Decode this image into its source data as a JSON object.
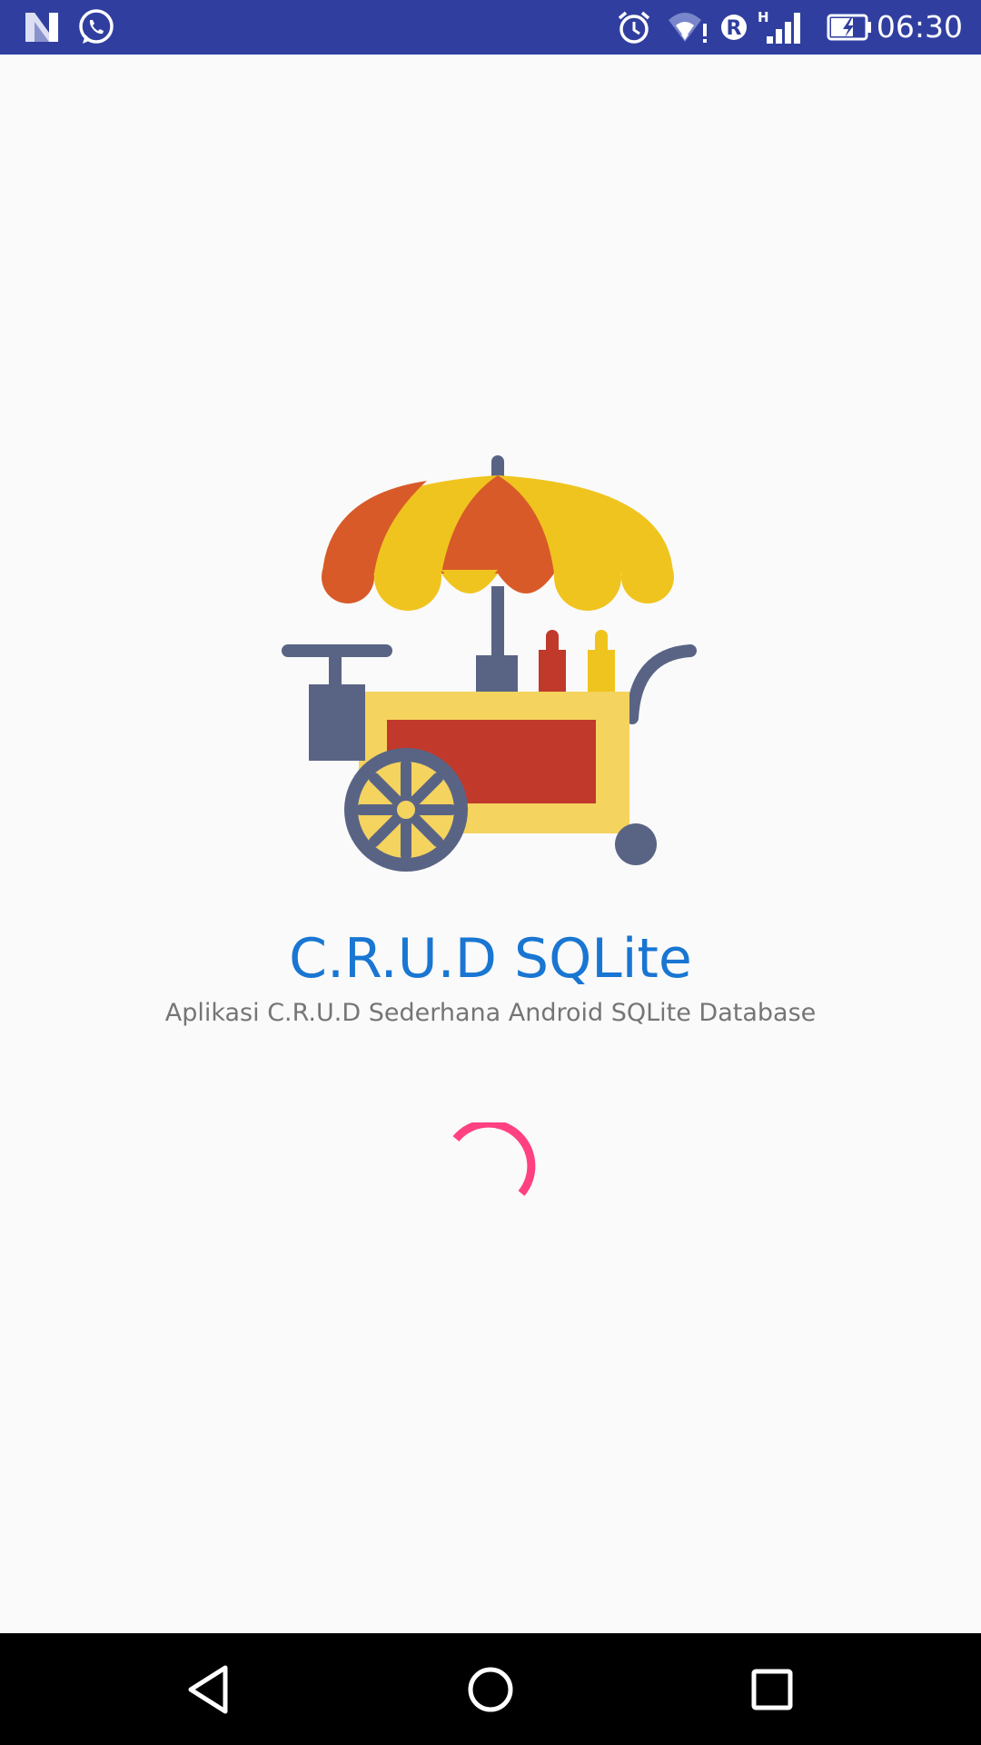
{
  "status_bar": {
    "time": "06:30",
    "background": "#303f9f",
    "icons": [
      "n-notification-icon",
      "whatsapp-icon",
      "alarm-icon",
      "wifi-icon",
      "roaming-r-icon",
      "signal-icon",
      "battery-charging-icon"
    ],
    "network_type": "H",
    "roaming_label": "R"
  },
  "splash": {
    "logo": "food-cart-icon",
    "title": "C.R.U.D SQLite",
    "subtitle": "Aplikasi C.R.U.D Sederhana Android SQLite Database",
    "title_color": "#1976d2",
    "loading": "loading-spinner-icon",
    "spinner_color": "#ff4081"
  },
  "navigation_bar": {
    "buttons": [
      "back-icon",
      "home-icon",
      "recents-icon"
    ]
  }
}
